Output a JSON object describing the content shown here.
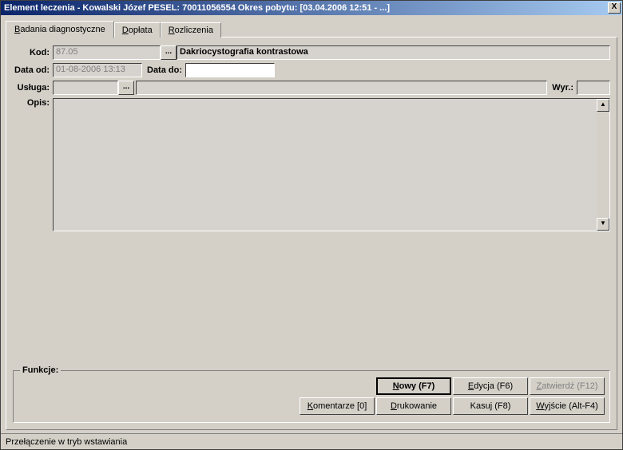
{
  "title": "Element leczenia -  Kowalski Józef PESEL: 70011056554 Okres pobytu: [03.04.2006 12:51 - ...]",
  "close_x": "X",
  "tabs": {
    "diag_pre": "B",
    "diag": "adania diagnostyczne",
    "dop_pre": "D",
    "dop": "opłata",
    "roz_pre": "R",
    "roz": "ozliczenia"
  },
  "labels": {
    "kod": "Kod:",
    "data_od": "Data od:",
    "data_do": "Data do:",
    "usluga": "Usługa:",
    "wyr": "Wyr.:",
    "opis": "Opis:",
    "funkcje": "Funkcje:"
  },
  "values": {
    "kod": "87.05",
    "kod_name": "Dakriocystografia kontrastowa",
    "data_od": "01-08-2006 13:13",
    "data_do": "",
    "usluga": "",
    "wyr": "",
    "opis": ""
  },
  "dots": "...",
  "buttons": {
    "nowy_pre": "N",
    "nowy": "owy (F7)",
    "edycja_pre": "E",
    "edycja": "dycja (F6)",
    "zatwierdz_pre": "Z",
    "zatwierdz": "atwierdź (F12)",
    "komentarze_pre": "K",
    "komentarze": "omentarze [0]",
    "drukowanie_pre": "D",
    "drukowanie": "rukowanie",
    "kasuj": "Kasu",
    "kasuj_mid": "j",
    "kasuj_post": " (F8)",
    "wyjscie_pre": "W",
    "wyjscie": "yjście (Alt-F4)"
  },
  "status": "Przełączenie w tryb wstawiania",
  "arrows": {
    "up": "▲",
    "down": "▼"
  }
}
